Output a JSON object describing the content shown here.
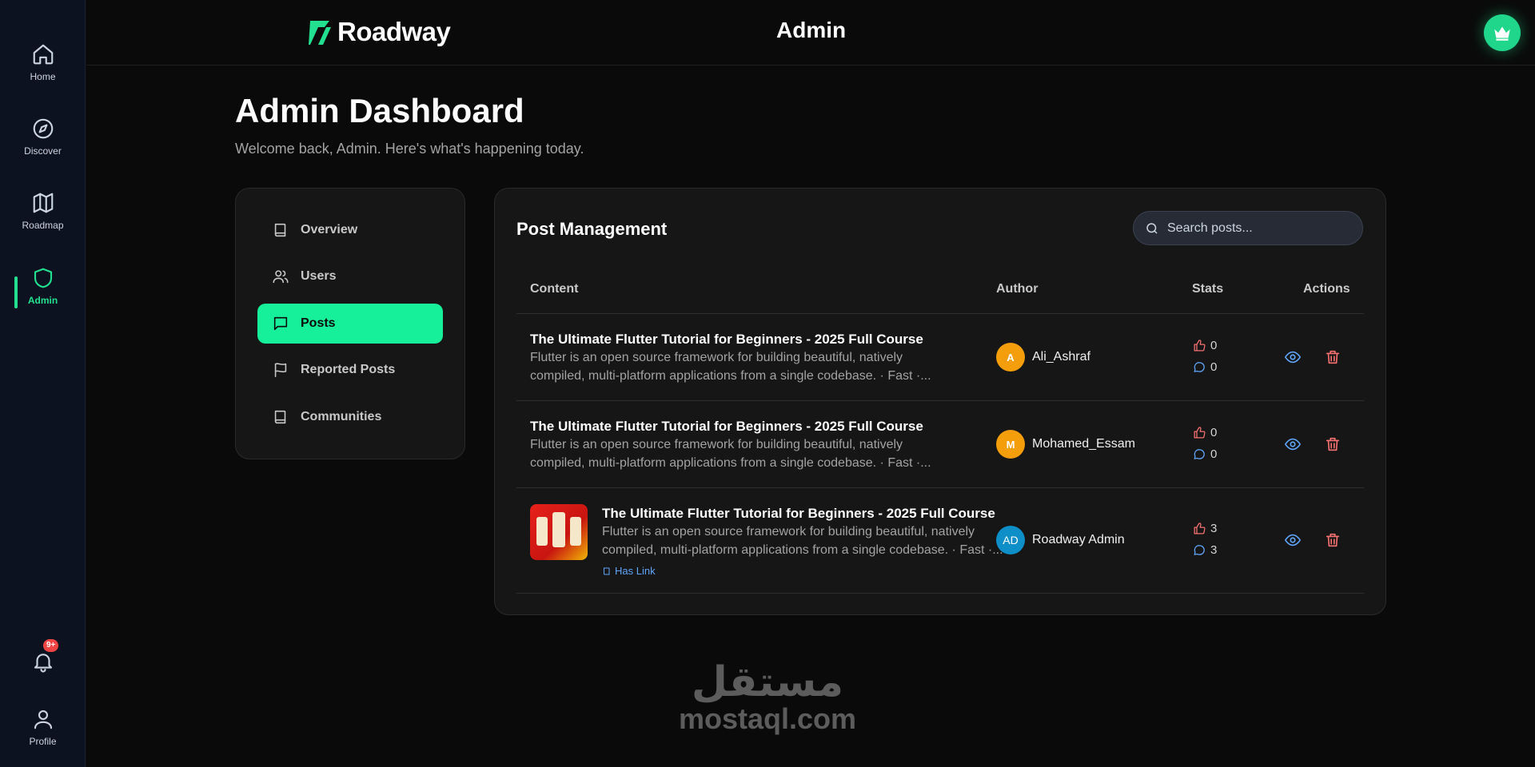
{
  "rail": {
    "items": [
      {
        "label": "Home",
        "icon": "home-icon"
      },
      {
        "label": "Discover",
        "icon": "compass-icon"
      },
      {
        "label": "Roadmap",
        "icon": "map-icon"
      },
      {
        "label": "Admin",
        "icon": "shield-icon"
      }
    ],
    "notifications_badge": "9+",
    "profile_label": "Profile"
  },
  "topbar": {
    "logo_text": "Roadway",
    "title": "Admin"
  },
  "header": {
    "title": "Admin Dashboard",
    "subtitle": "Welcome back, Admin. Here's what's happening today."
  },
  "nav": {
    "items": [
      {
        "label": "Overview",
        "icon": "book-icon"
      },
      {
        "label": "Users",
        "icon": "users-icon"
      },
      {
        "label": "Posts",
        "icon": "message-square-icon"
      },
      {
        "label": "Reported Posts",
        "icon": "flag-icon"
      },
      {
        "label": "Communities",
        "icon": "book-icon"
      }
    ],
    "active": "Posts"
  },
  "posts": {
    "title": "Post Management",
    "search_placeholder": "Search posts...",
    "columns": [
      "Content",
      "Author",
      "Stats",
      "Actions"
    ],
    "rows": [
      {
        "title": "The Ultimate Flutter Tutorial for Beginners - 2025 Full Course",
        "excerpt": "Flutter is an open source framework for building beautiful, natively compiled, multi-platform applications from a single codebase. · Fast ·...",
        "author_initial": "A",
        "author": "Ali_Ashraf",
        "likes": "0",
        "comments": "0"
      },
      {
        "title": "The Ultimate Flutter Tutorial for Beginners - 2025 Full Course",
        "excerpt": "Flutter is an open source framework for building beautiful, natively compiled, multi-platform applications from a single codebase. · Fast ·...",
        "author_initial": "M",
        "author": "Mohamed_Essam",
        "likes": "0",
        "comments": "0"
      },
      {
        "title": "The Ultimate Flutter Tutorial for Beginners - 2025 Full Course",
        "excerpt": "Flutter is an open source framework for building beautiful, natively compiled, multi-platform applications from a single codebase. · Fast ·...",
        "author_initial": "AD",
        "author": "Roadway Admin",
        "likes": "3",
        "comments": "3",
        "link_label": "Has Link"
      }
    ]
  },
  "watermark": {
    "arabic": "مستقل",
    "latin": "mostaql.com"
  },
  "colors": {
    "accent": "#16f09a",
    "background": "#0a0a0a",
    "card": "#161616",
    "like": "#f87171",
    "comment": "#60a5fa",
    "avatar_orange": "#f59e0b",
    "avatar_blue": "#0e8fc7"
  }
}
